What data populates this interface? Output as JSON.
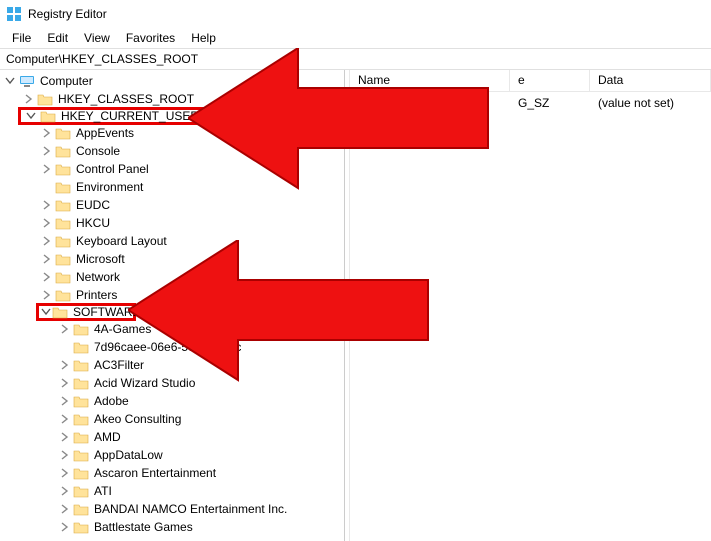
{
  "window": {
    "title": "Registry Editor"
  },
  "menu": {
    "file": "File",
    "edit": "Edit",
    "view": "View",
    "favorites": "Favorites",
    "help": "Help"
  },
  "address": {
    "path": "Computer\\HKEY_CLASSES_ROOT"
  },
  "columns": {
    "name": "Name",
    "type": "Type",
    "data": "Data"
  },
  "list": {
    "row0": {
      "name_partial": "",
      "type_partial": "G_SZ",
      "data": "(value not set)"
    }
  },
  "tree": {
    "root": "Computer",
    "hives": {
      "hkcr": "HKEY_CLASSES_ROOT",
      "hkcu": "HKEY_CURRENT_USER"
    },
    "hkcu_children": {
      "appevents": "AppEvents",
      "console": "Console",
      "controlpanel": "Control Panel",
      "environment": "Environment",
      "eudc": "EUDC",
      "hkcu2": "HKCU",
      "keyboard": "Keyboard Layout",
      "microsoft": "Microsoft",
      "network": "Network",
      "printers": "Printers",
      "software": "SOFTWARE"
    },
    "software_children": {
      "a4": "4A-Games",
      "guid": "7d96caee-06e6-597c-9f2f-c",
      "ac3": "AC3Filter",
      "acid": "Acid Wizard Studio",
      "adobe": "Adobe",
      "akeo": "Akeo Consulting",
      "amd": "AMD",
      "appdatalow": "AppDataLow",
      "ascaron": "Ascaron Entertainment",
      "ati": "ATI",
      "bandai": "BANDAI NAMCO Entertainment Inc.",
      "battlestate": "Battlestate Games"
    }
  }
}
